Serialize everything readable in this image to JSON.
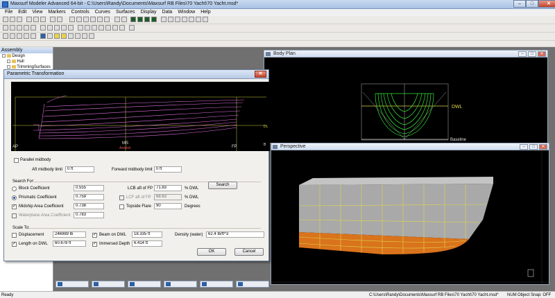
{
  "window": {
    "title": "Maxsurf Modeler Advanced 64-bit - C:\\Users\\Randy\\Documents\\Maxsurf RB Files\\70 Yacht\\70 Yacht.msd*",
    "minimize": "–",
    "maximize": "□",
    "close": "✕"
  },
  "menu": [
    "File",
    "Edit",
    "View",
    "Markers",
    "Controls",
    "Curves",
    "Surfaces",
    "Display",
    "Data",
    "Window",
    "Help"
  ],
  "assembly": {
    "title": "Assembly",
    "items": [
      "Design",
      "Hull",
      "TrimmingSurfaces"
    ]
  },
  "body_plan": {
    "title": "Body Plan",
    "dwl_label": "DWL",
    "baseline_label": "Baseline"
  },
  "perspective": {
    "title": "Perspective"
  },
  "dialog": {
    "title": "Parametric Transformation",
    "close": "✕",
    "preview": {
      "ap_label": "AP",
      "ms_label": "MS",
      "amidsh_label": "Amidsh",
      "fp_label": "FP",
      "dl_label": "DL",
      "b_label": "B"
    },
    "parallel_midbody": {
      "label": "Parallel midbody",
      "checked": false
    },
    "aft_midbody_limit": {
      "label": "Aft midbody limit",
      "value": "0 ft"
    },
    "forward_midbody_limit": {
      "label": "Forward midbody limit",
      "value": "0 ft"
    },
    "search_for_label": "Search For:",
    "block_coefficient": {
      "label": "Block Coefficient",
      "value": "0.555",
      "selected": false
    },
    "prismatic_coefficient": {
      "label": "Prismatic Coefficient",
      "value": "0.759",
      "selected": true
    },
    "midship_area_coefficient": {
      "label": "Midship Area Coefficient",
      "value": "0.738",
      "checked": true
    },
    "waterplane_area_coefficient": {
      "label": "Waterplane Area Coefficient",
      "value": "0.783",
      "checked": false
    },
    "lcb": {
      "label": "LCB aft of FP",
      "value": "71.83",
      "unit": "% DWL"
    },
    "lcf": {
      "label": "LCF aft of FP",
      "value": "68.63",
      "unit": "% DWL"
    },
    "topside_flare": {
      "label": "Topside Flare",
      "value": "90",
      "unit": "Degrees",
      "checked": false
    },
    "search_button": "Search",
    "scale_to_label": "Scale To:",
    "displacement": {
      "label": "Displacement",
      "value": "246989 lb",
      "checked": false
    },
    "length_on_dwl": {
      "label": "Length on DWL",
      "value": "60.678 ft",
      "checked": true
    },
    "beam_on_dwl": {
      "label": "Beam on DWL",
      "value": "18.335 ft",
      "checked": true
    },
    "immersed_depth": {
      "label": "Immersed Depth",
      "value": "6.414 ft",
      "checked": true
    },
    "density": {
      "label": "Density (water)",
      "value": "62.4 lb/ft^3"
    },
    "ok_button": "OK",
    "cancel_button": "Cancel"
  },
  "statusbar": {
    "left": "Ready",
    "path": "C:\\Users\\Randy\\Documents\\Maxsurf RB Files\\70 Yacht\\70 Yacht.msd*",
    "num": "NUM",
    "snap": "Object Snap: OFF"
  },
  "colors": {
    "wireframe_green": "#39e53a",
    "hull_pink": "#e070e0",
    "hull_orange": "#d9731c",
    "dwl_yellow": "#e0d84a"
  }
}
